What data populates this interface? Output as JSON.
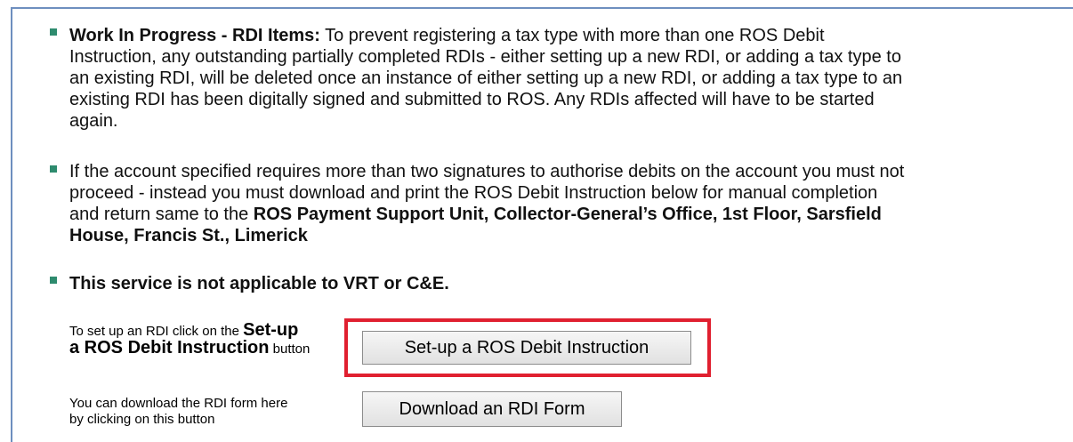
{
  "items": [
    {
      "bold_lead": "Work In Progress - RDI Items:",
      "lines": [
        " To prevent registering a tax type with more than one ROS Debit",
        "Instruction, any outstanding partially completed RDIs - either setting up a new RDI, or adding a tax type to",
        "an existing RDI, will be deleted once an instance of either setting up a new RDI, or adding a tax type to an",
        "existing RDI has been digitally signed and submitted to ROS. Any RDIs affected will have to be started",
        "again."
      ]
    },
    {
      "lines": [
        "If the account specified requires more than two signatures to authorise debits on the account you must not",
        "proceed - instead you must download and print the ROS Debit Instruction below for manual completion",
        "and return same to the "
      ],
      "bold_tail_1": "ROS Payment Support Unit, Collector-General’s Office, 1st Floor, Sarsfield",
      "bold_tail_2": "House, Francis St., Limerick"
    },
    {
      "bold_text": "This service is not applicable to VRT or C&E."
    }
  ],
  "setup": {
    "prefix": "To set up an RDI click on the ",
    "bold_1": "Set-up",
    "bold_2": "a ROS Debit Instruction",
    "suffix": " button",
    "button_label": "Set-up a ROS Debit Instruction"
  },
  "download": {
    "line1": "You can download the RDI form here",
    "line2": "by clicking on this button",
    "button_label": "Download an RDI Form"
  },
  "colors": {
    "frame_border": "#6e8fbf",
    "bullet": "#2e8b6e",
    "highlight": "#e02030"
  }
}
